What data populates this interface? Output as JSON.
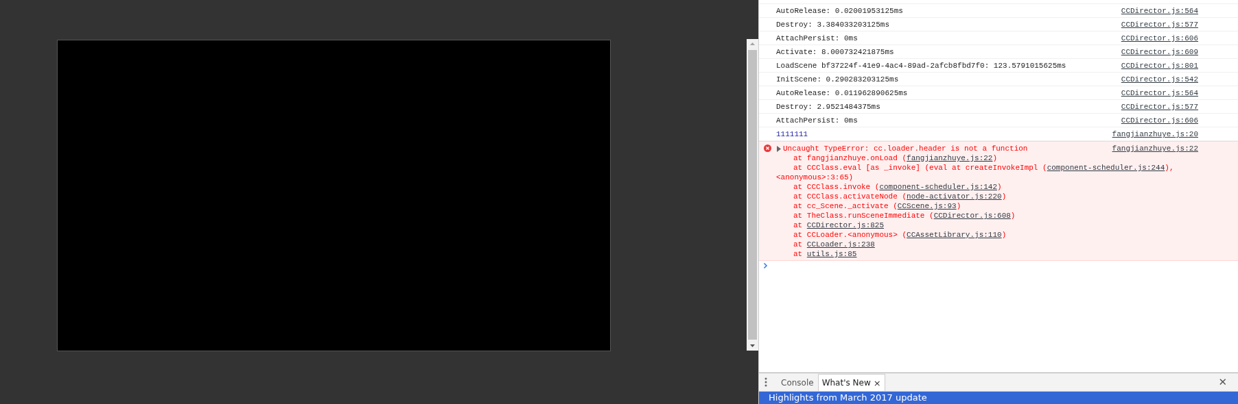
{
  "console": {
    "messages": [
      {
        "kind": "log",
        "text": "AutoRelease: 0.02001953125ms",
        "source": "CCDirector.js:564"
      },
      {
        "kind": "log",
        "text": "Destroy: 3.384033203125ms",
        "source": "CCDirector.js:577"
      },
      {
        "kind": "log",
        "text": "AttachPersist: 0ms",
        "source": "CCDirector.js:606"
      },
      {
        "kind": "log",
        "text": "Activate: 8.000732421875ms",
        "source": "CCDirector.js:609"
      },
      {
        "kind": "log",
        "text": "LoadScene bf37224f-41e9-4ac4-89ad-2afcb8fbd7f0: 123.5791015625ms",
        "source": "CCDirector.js:801"
      },
      {
        "kind": "log",
        "text": "InitScene: 0.290283203125ms",
        "source": "CCDirector.js:542"
      },
      {
        "kind": "log",
        "text": "AutoRelease: 0.011962890625ms",
        "source": "CCDirector.js:564"
      },
      {
        "kind": "log",
        "text": "Destroy: 2.9521484375ms",
        "source": "CCDirector.js:577"
      },
      {
        "kind": "log",
        "text": "AttachPersist: 0ms",
        "source": "CCDirector.js:606"
      },
      {
        "kind": "number",
        "text": "1111111",
        "source": "fangjianzhuye.js:20"
      },
      {
        "kind": "error",
        "text": "Uncaught TypeError: cc.loader.header is not a function",
        "source": "fangjianzhuye.js:22",
        "expanded": false,
        "stack": [
          {
            "kind": "frame",
            "parts": [
              {
                "kind": "text",
                "text": "at fangjianzhuye.onLoad ("
              },
              {
                "kind": "link",
                "text": "fangjianzhuye.js:22"
              },
              {
                "kind": "text",
                "text": ")"
              }
            ]
          },
          {
            "kind": "frame",
            "parts": [
              {
                "kind": "text",
                "text": "at CCClass.eval [as _invoke] (eval at createInvokeImpl ("
              },
              {
                "kind": "link",
                "text": "component-scheduler.js:244"
              },
              {
                "kind": "text",
                "text": "),"
              }
            ]
          },
          {
            "kind": "wrap",
            "parts": [
              {
                "kind": "text",
                "text": "<anonymous>:3:65)"
              }
            ]
          },
          {
            "kind": "frame",
            "parts": [
              {
                "kind": "text",
                "text": "at CCClass.invoke ("
              },
              {
                "kind": "link",
                "text": "component-scheduler.js:142"
              },
              {
                "kind": "text",
                "text": ")"
              }
            ]
          },
          {
            "kind": "frame",
            "parts": [
              {
                "kind": "text",
                "text": "at CCClass.activateNode ("
              },
              {
                "kind": "link",
                "text": "node-activator.js:220"
              },
              {
                "kind": "text",
                "text": ")"
              }
            ]
          },
          {
            "kind": "frame",
            "parts": [
              {
                "kind": "text",
                "text": "at cc_Scene._activate ("
              },
              {
                "kind": "link",
                "text": "CCScene.js:93"
              },
              {
                "kind": "text",
                "text": ")"
              }
            ]
          },
          {
            "kind": "frame",
            "parts": [
              {
                "kind": "text",
                "text": "at TheClass.runSceneImmediate ("
              },
              {
                "kind": "link",
                "text": "CCDirector.js:608"
              },
              {
                "kind": "text",
                "text": ")"
              }
            ]
          },
          {
            "kind": "frame",
            "parts": [
              {
                "kind": "text",
                "text": "at "
              },
              {
                "kind": "link",
                "text": "CCDirector.js:825"
              }
            ]
          },
          {
            "kind": "frame",
            "parts": [
              {
                "kind": "text",
                "text": "at CCLoader.<anonymous> ("
              },
              {
                "kind": "link",
                "text": "CCAssetLibrary.js:110"
              },
              {
                "kind": "text",
                "text": ")"
              }
            ]
          },
          {
            "kind": "frame",
            "parts": [
              {
                "kind": "text",
                "text": "at "
              },
              {
                "kind": "link",
                "text": "CCLoader.js:238"
              }
            ]
          },
          {
            "kind": "frame",
            "parts": [
              {
                "kind": "text",
                "text": "at "
              },
              {
                "kind": "link",
                "text": "utils.js:85"
              }
            ]
          }
        ]
      }
    ]
  },
  "drawer": {
    "tabs": [
      {
        "label": "Console",
        "selected": false,
        "closable": false
      },
      {
        "label": "What's New",
        "selected": true,
        "closable": true
      }
    ],
    "close": "✕",
    "tab_close": "×",
    "banner": "Highlights from March 2017 update"
  }
}
